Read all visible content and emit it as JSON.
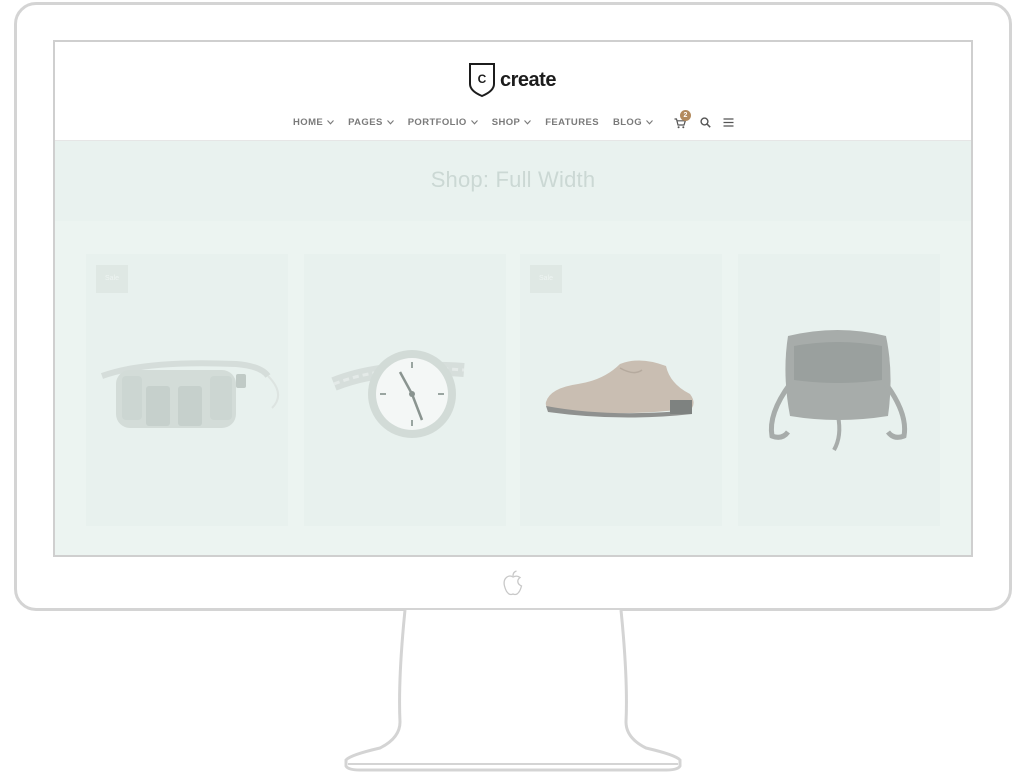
{
  "logo": {
    "letter": "C",
    "text": "create"
  },
  "nav": {
    "items": [
      {
        "label": "HOME",
        "dropdown": true
      },
      {
        "label": "PAGES",
        "dropdown": true
      },
      {
        "label": "PORTFOLIO",
        "dropdown": true
      },
      {
        "label": "SHOP",
        "dropdown": true
      },
      {
        "label": "FEATURES",
        "dropdown": false
      },
      {
        "label": "BLOG",
        "dropdown": true
      }
    ],
    "cart_count": "2",
    "icons": [
      "cart-icon",
      "search-icon",
      "menu-icon"
    ]
  },
  "page": {
    "title": "Shop: Full Width"
  },
  "products": [
    {
      "image": "belt-bag",
      "sale_label": "Sale"
    },
    {
      "image": "wrist-watch"
    },
    {
      "image": "leather-shoe",
      "sale_label": "Sale"
    },
    {
      "image": "leather-bag"
    }
  ],
  "colors": {
    "content_bg": "#ecf4f1",
    "badge": "#b38a5e",
    "frame": "#d4d4d4"
  }
}
